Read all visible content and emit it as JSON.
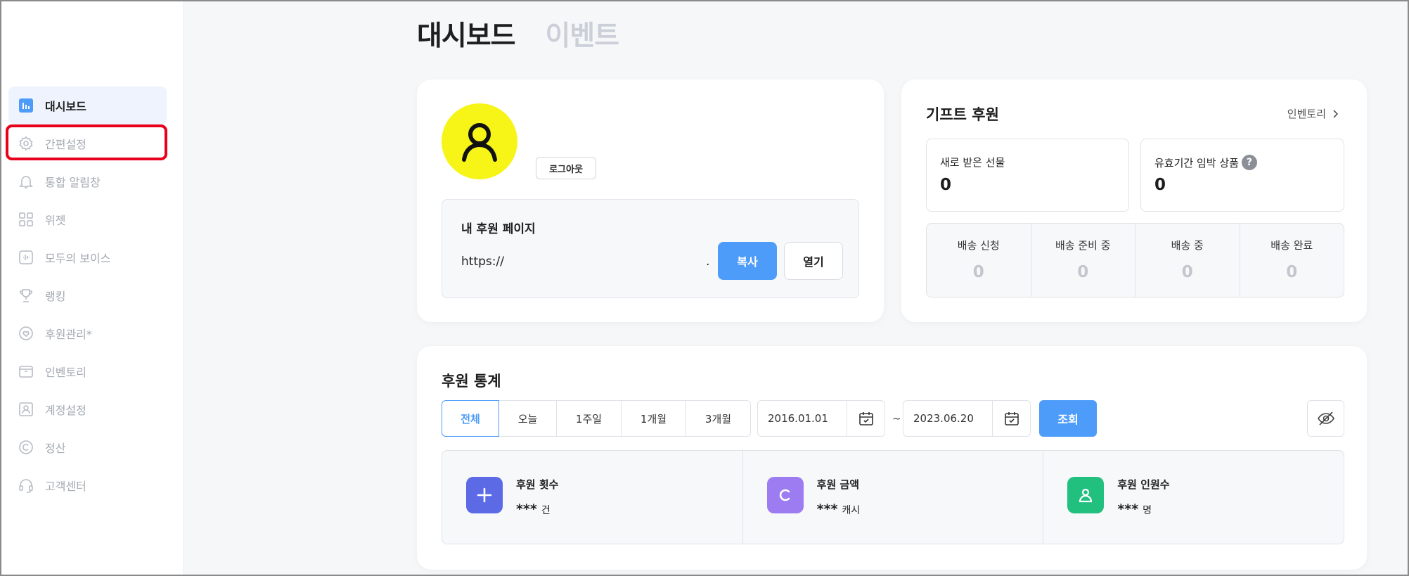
{
  "sidebar": {
    "items": [
      {
        "label": "대시보드",
        "icon": "chart-bar-icon"
      },
      {
        "label": "간편설정",
        "icon": "gear-icon"
      },
      {
        "label": "통합 알림창",
        "icon": "bell-icon"
      },
      {
        "label": "위젯",
        "icon": "grid-icon"
      },
      {
        "label": "모두의 보이스",
        "icon": "voice-icon"
      },
      {
        "label": "랭킹",
        "icon": "trophy-icon"
      },
      {
        "label": "후원관리*",
        "icon": "heart-icon"
      },
      {
        "label": "인벤토리",
        "icon": "box-icon"
      },
      {
        "label": "계정설정",
        "icon": "user-card-icon"
      },
      {
        "label": "정산",
        "icon": "copyright-icon"
      },
      {
        "label": "고객센터",
        "icon": "headset-icon"
      }
    ]
  },
  "tabs": {
    "dashboard": "대시보드",
    "event": "이벤트"
  },
  "profile": {
    "logout": "로그아웃",
    "page_title": "내 후원 페이지",
    "url": "https://",
    "url_suffix": ".",
    "copy": "복사",
    "open": "열기"
  },
  "gift": {
    "title": "기프트 후원",
    "inventory_link": "인벤토리",
    "new_gift_label": "새로 받은 선물",
    "new_gift_value": "0",
    "expiring_label": "유효기간 임박 상품",
    "expiring_value": "0",
    "help": "?",
    "delivery": [
      {
        "label": "배송 신청",
        "value": "0"
      },
      {
        "label": "배송 준비 중",
        "value": "0"
      },
      {
        "label": "배송 중",
        "value": "0"
      },
      {
        "label": "배송 완료",
        "value": "0"
      }
    ]
  },
  "stats": {
    "title": "후원 통계",
    "periods": [
      "전체",
      "오늘",
      "1주일",
      "1개월",
      "3개월"
    ],
    "start_date": "2016.01.01",
    "end_date": "2023.06.20",
    "separator": "~",
    "search": "조회",
    "cards": [
      {
        "label": "후원 횟수",
        "value": "***",
        "unit": "건",
        "color": "#5c6ae6",
        "icon": "plus-icon"
      },
      {
        "label": "후원 금액",
        "value": "***",
        "unit": "캐시",
        "color": "#9c7cf0",
        "icon": "coin-c-icon"
      },
      {
        "label": "후원 인원수",
        "value": "***",
        "unit": "명",
        "color": "#21c07f",
        "icon": "person-icon"
      }
    ]
  },
  "colors": {
    "accent": "#4e9cf9",
    "avatar": "#f7f418",
    "highlight": "#e8001c"
  }
}
